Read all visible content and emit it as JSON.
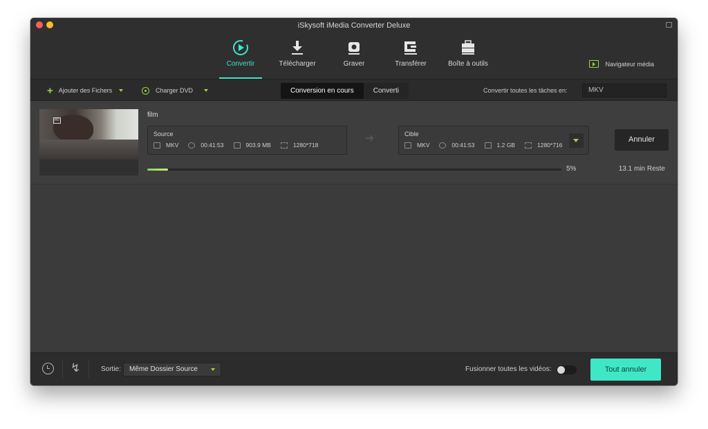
{
  "window": {
    "title": "iSkysoft iMedia Converter Deluxe"
  },
  "nav": {
    "tabs": [
      {
        "label": "Convertir",
        "icon": "convert-play-icon",
        "active": true
      },
      {
        "label": "Télécharger",
        "icon": "download-icon",
        "active": false
      },
      {
        "label": "Graver",
        "icon": "burn-disc-icon",
        "active": false
      },
      {
        "label": "Transférer",
        "icon": "transfer-icon",
        "active": false
      },
      {
        "label": "Boîte à outils",
        "icon": "toolbox-icon",
        "active": false
      }
    ],
    "media_browser": "Navigateur média"
  },
  "toolbar": {
    "add_files": "Ajouter des Fichers",
    "load_dvd": "Charger DVD",
    "segment_active": "Conversion en cours",
    "segment_inactive": "Converti",
    "convert_all_label": "Convertir toutes les tâches en:",
    "convert_all_format": "MKV"
  },
  "file": {
    "name": "film",
    "source": {
      "header": "Source",
      "format": "MKV",
      "duration": "00:41:53",
      "size": "903.9 MB",
      "resolution": "1280*718"
    },
    "target": {
      "header": "Cible",
      "format": "MKV",
      "duration": "00:41:53",
      "size": "1.2 GB",
      "resolution": "1280*716"
    },
    "cancel": "Annuler",
    "progress_percent": 5,
    "progress_label": "5%",
    "remaining": "13.1 min Reste"
  },
  "footer": {
    "output_label": "Sortie:",
    "output_value": "Même Dossier Source",
    "merge_label": "Fusionner toutes les vidéos:",
    "merge_on": false,
    "cancel_all": "Tout annuler"
  },
  "colors": {
    "accent": "#3ee8c7",
    "green": "#9bd34c"
  }
}
